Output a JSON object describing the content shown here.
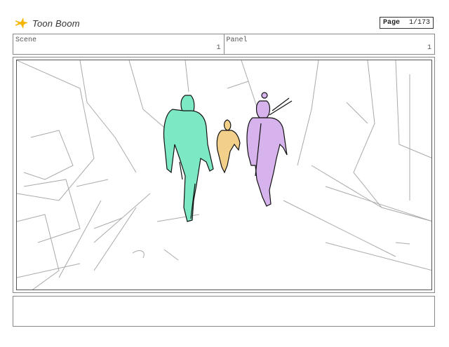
{
  "brand": {
    "name": "Toon Boom",
    "icon": "toon-boom-star-icon",
    "icon_color": "#f5b400"
  },
  "page": {
    "label": "Page",
    "value": "1/173"
  },
  "header": {
    "scene_label": "Scene",
    "scene_value": "1",
    "panel_label": "Panel",
    "panel_value": "1"
  },
  "sketch": {
    "colors": {
      "green_figure": "#7de8c4",
      "yellow_figure": "#f3d08a",
      "purple_figure": "#d6b3ec",
      "lines": "#aaaaaa"
    }
  },
  "notes": {
    "text": ""
  }
}
